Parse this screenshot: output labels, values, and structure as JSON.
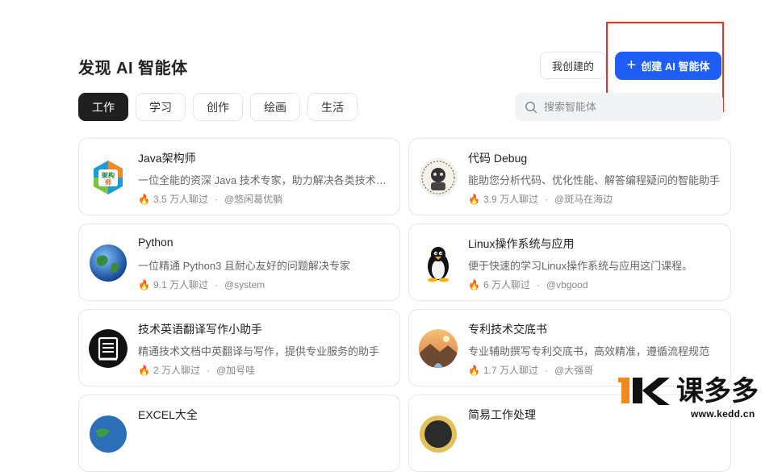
{
  "header": {
    "title": "发现 AI 智能体",
    "mine_label": "我创建的",
    "create_label": "创建 AI 智能体",
    "brand_color": "#1f5ef5",
    "highlight_color": "#e8302a"
  },
  "tabs": [
    {
      "label": "工作",
      "active": true
    },
    {
      "label": "学习",
      "active": false
    },
    {
      "label": "创作",
      "active": false
    },
    {
      "label": "绘画",
      "active": false
    },
    {
      "label": "生活",
      "active": false
    }
  ],
  "search": {
    "placeholder": "搜索智能体",
    "value": ""
  },
  "cards": [
    {
      "name": "Java架构师",
      "desc": "一位全能的资深 Java 技术专家，助力解决各类技术问题",
      "stats": "3.5 万人聊过",
      "author": "@悠闲葛优躺",
      "icon": "java-architect-icon"
    },
    {
      "name": "代码 Debug",
      "desc": "能助您分析代码、优化性能、解答编程疑问的智能助手",
      "stats": "3.9 万人聊过",
      "author": "@斑马在海边",
      "icon": "debug-icon"
    },
    {
      "name": "Python",
      "desc": "一位精通 Python3 且耐心友好的问题解决专家",
      "stats": "9.1 万人聊过",
      "author": "@system",
      "icon": "globe-icon"
    },
    {
      "name": "Linux操作系统与应用",
      "desc": "便于快速的学习Linux操作系统与应用这门课程。",
      "stats": "6 万人聊过",
      "author": "@vbgood",
      "icon": "penguin-icon"
    },
    {
      "name": "技术英语翻译写作小助手",
      "desc": "精通技术文档中英翻译与写作，提供专业服务的助手",
      "stats": "2 万人聊过",
      "author": "@加号哇",
      "icon": "document-icon"
    },
    {
      "name": "专利技术交底书",
      "desc": "专业辅助撰写专利交底书，高效精准，遵循流程规范",
      "stats": "1.7 万人聊过",
      "author": "@大强哥",
      "icon": "landscape-icon"
    },
    {
      "name": "EXCEL大全",
      "desc": "",
      "stats": "",
      "author": "",
      "icon": "excel-icon"
    },
    {
      "name": "简易工作处理",
      "desc": "",
      "stats": "",
      "author": "",
      "icon": "work-icon"
    }
  ],
  "java_icon_text": [
    "架构",
    "师"
  ],
  "watermark": {
    "logo_text": "课多多",
    "url": "www.kedd.cn"
  }
}
